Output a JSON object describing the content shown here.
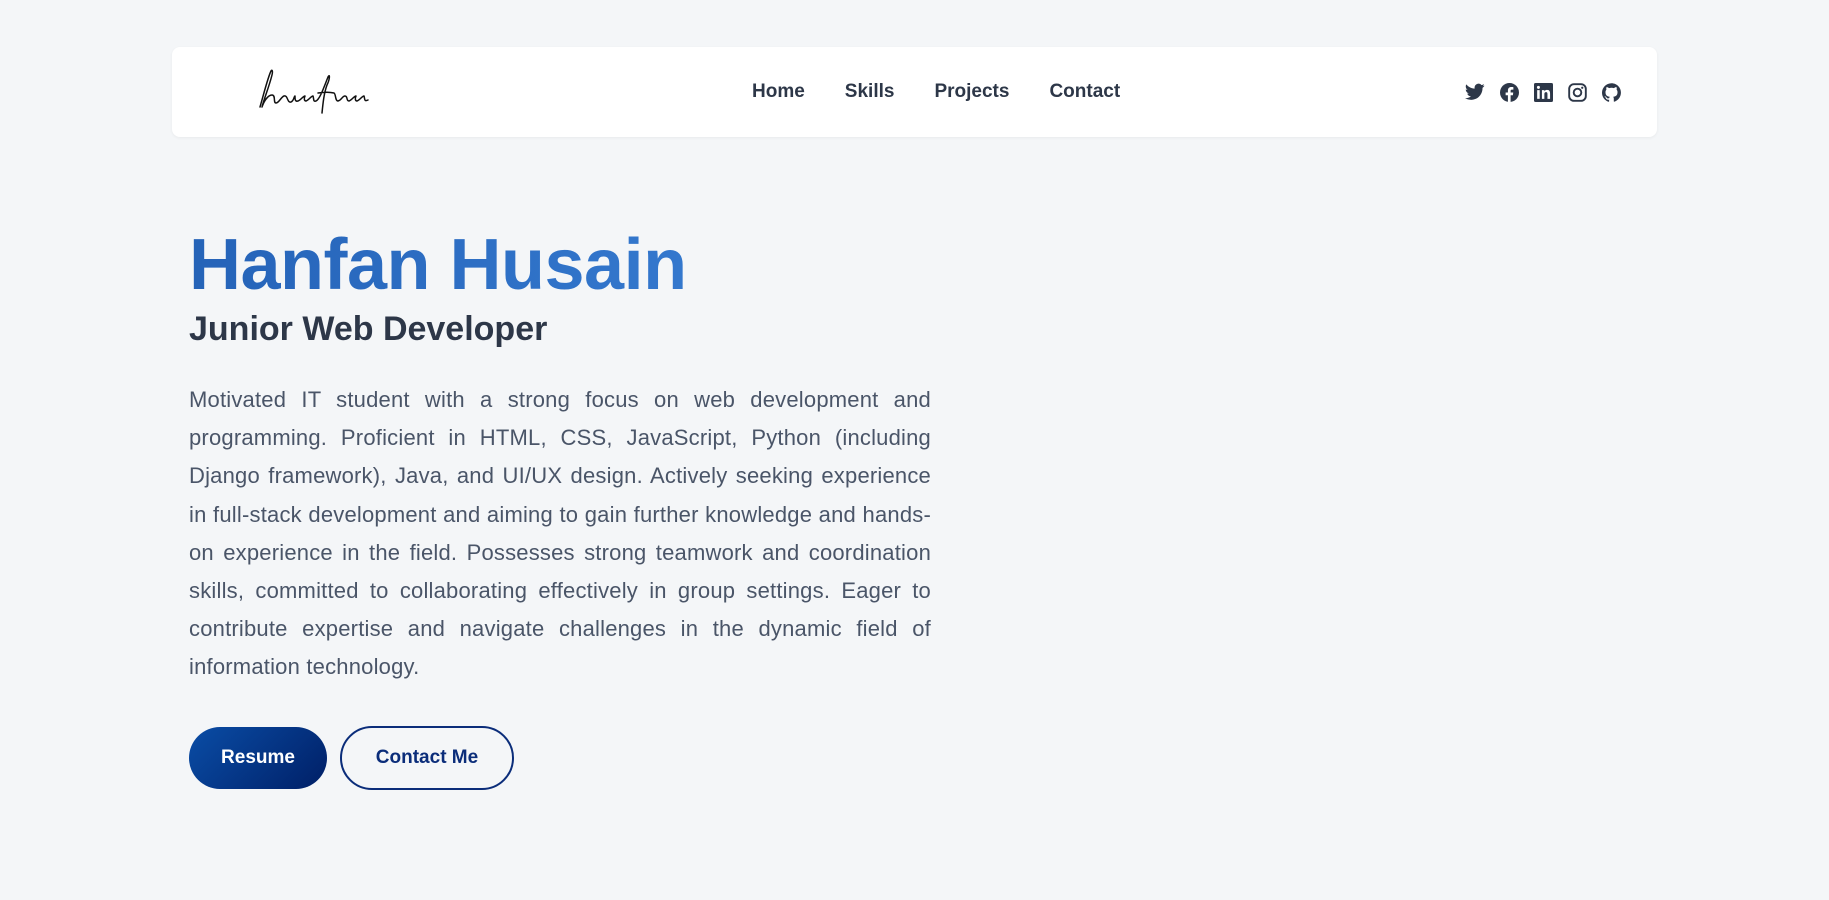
{
  "nav": {
    "logo_text": "hanfan",
    "links": [
      {
        "label": "Home"
      },
      {
        "label": "Skills"
      },
      {
        "label": "Projects"
      },
      {
        "label": "Contact"
      }
    ],
    "socials": [
      {
        "icon": "twitter-icon"
      },
      {
        "icon": "facebook-icon"
      },
      {
        "icon": "linkedin-icon"
      },
      {
        "icon": "instagram-icon"
      },
      {
        "icon": "github-icon"
      }
    ]
  },
  "hero": {
    "name": "Hanfan Husain",
    "role": "Junior Web Developer",
    "description": "Motivated IT student with a strong focus on web development and programming. Proficient in HTML, CSS, JavaScript, Python (including Django framework), Java, and UI/UX design. Actively seeking experience in full-stack development and aiming to gain further knowledge and hands-on experience in the field. Possesses strong teamwork and coordination skills, committed to collaborating effectively in group settings. Eager to contribute expertise and navigate challenges in the dynamic field of information technology.",
    "resume_label": "Resume",
    "contact_label": "Contact Me"
  },
  "colors": {
    "background": "#f4f6f8",
    "name_gradient_start": "#2563b8",
    "name_gradient_end": "#3b82d8",
    "primary_button_start": "#0a4da6",
    "primary_button_end": "#001f66",
    "outline_button": "#0b2d7a",
    "text_dark": "#2d3748",
    "text_body": "#4a5568"
  }
}
